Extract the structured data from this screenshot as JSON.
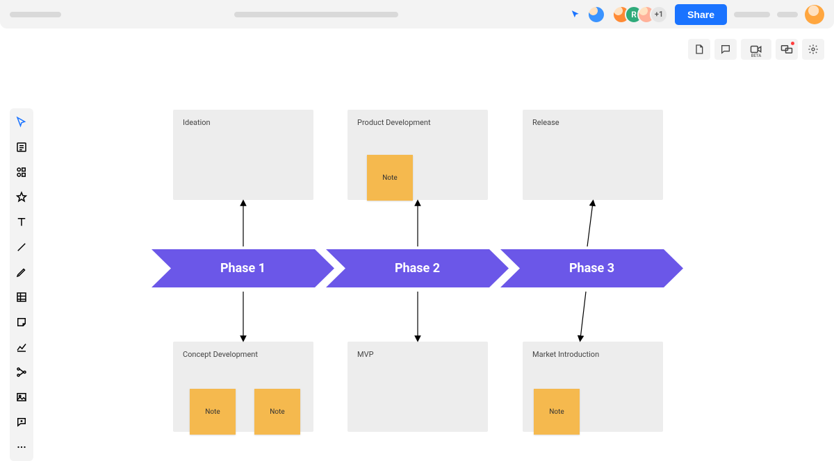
{
  "header": {
    "share_label": "Share",
    "avatar_overflow": "+1",
    "collaborators": [
      {
        "name": "collab-1",
        "style": "avatar-orange"
      },
      {
        "name": "collab-2",
        "style": "avatar-green",
        "initial": "R"
      },
      {
        "name": "collab-3",
        "style": "avatar-peach"
      }
    ],
    "right_toolbar": {
      "beta_label": "BETA"
    }
  },
  "left_toolbar": {
    "tools": [
      {
        "name": "select-tool",
        "active": true
      },
      {
        "name": "text-block-tool",
        "active": false
      },
      {
        "name": "shapes-tool",
        "active": false
      },
      {
        "name": "star-tool",
        "active": false
      },
      {
        "name": "text-tool",
        "active": false
      },
      {
        "name": "line-tool",
        "active": false
      },
      {
        "name": "pencil-tool",
        "active": false
      },
      {
        "name": "table-tool",
        "active": false
      },
      {
        "name": "sticky-note-tool",
        "active": false
      },
      {
        "name": "chart-tool",
        "active": false
      },
      {
        "name": "connector-tool",
        "active": false
      },
      {
        "name": "image-tool",
        "active": false
      },
      {
        "name": "comment-tool",
        "active": false
      },
      {
        "name": "more-tools",
        "active": false
      }
    ]
  },
  "diagram": {
    "phases": [
      {
        "label": "Phase 1"
      },
      {
        "label": "Phase 2"
      },
      {
        "label": "Phase 3"
      }
    ],
    "blocks": [
      {
        "title": "Ideation"
      },
      {
        "title": "Product Development"
      },
      {
        "title": "Release"
      },
      {
        "title": "Concept Development"
      },
      {
        "title": "MVP"
      },
      {
        "title": "Market Introduction"
      }
    ],
    "stickies": [
      {
        "label": "Note"
      },
      {
        "label": "Note"
      },
      {
        "label": "Note"
      },
      {
        "label": "Note"
      }
    ],
    "phase_color": "#6b57e8"
  }
}
